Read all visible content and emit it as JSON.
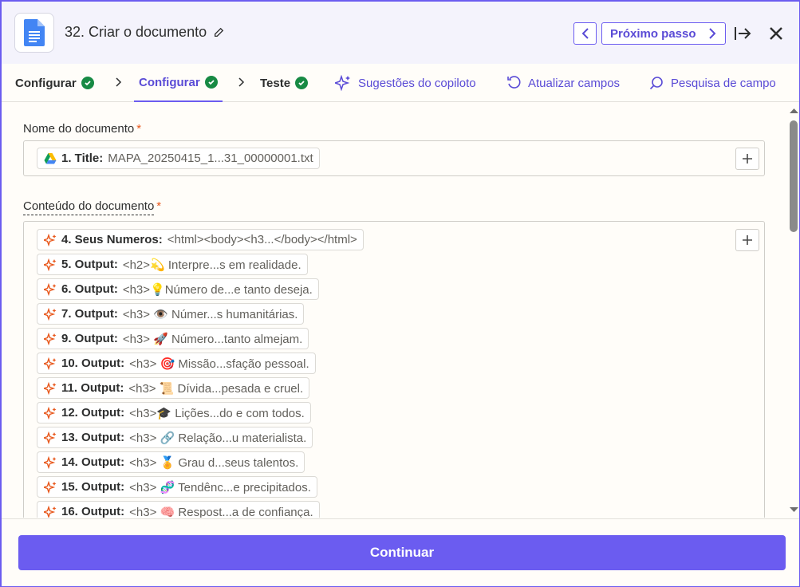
{
  "header": {
    "step_title": "32. Criar o documento",
    "next_step_label": "Próximo passo"
  },
  "tabs": [
    {
      "label": "Configurar",
      "done": true
    },
    {
      "label": "Configurar",
      "done": true,
      "active": true
    },
    {
      "label": "Teste",
      "done": true
    }
  ],
  "actions": {
    "copilot": "Sugestões do copiloto",
    "refresh": "Atualizar campos",
    "search": "Pesquisa de campo"
  },
  "fields": {
    "name": {
      "label": "Nome do documento",
      "required": "*",
      "pill": {
        "num": "1. Title:",
        "val": "MAPA_20250415_1...31_00000001.txt"
      }
    },
    "content": {
      "label": "Conteúdo do documento",
      "required": "*",
      "pills": [
        {
          "num": "4. Seus Numeros:",
          "val": "<html><body><h3...</body></html>"
        },
        {
          "num": "5. Output:",
          "val": "<h2>💫 Interpre...s em realidade."
        },
        {
          "num": "6. Output:",
          "val": "<h3>💡Número de...e tanto deseja."
        },
        {
          "num": "7. Output:",
          "val": "<h3> 👁️  Númer...s humanitárias."
        },
        {
          "num": "9. Output:",
          "val": "<h3> 🚀 Número...tanto almejam."
        },
        {
          "num": "10. Output:",
          "val": "<h3> 🎯 Missão...sfação pessoal."
        },
        {
          "num": "11. Output:",
          "val": "<h3> 📜  Dívida...pesada e cruel."
        },
        {
          "num": "12. Output:",
          "val": "<h3>🎓  Lições...do e com todos."
        },
        {
          "num": "13. Output:",
          "val": "<h3> 🔗 Relação...u materialista."
        },
        {
          "num": "14. Output:",
          "val": "<h3> 🏅 Grau d...seus talentos."
        },
        {
          "num": "15. Output:",
          "val": "<h3> 🧬 Tendênc...e precipitados."
        },
        {
          "num": "16. Output:",
          "val": "<h3> 🧠 Respost...a de confiança."
        }
      ]
    }
  },
  "footer": {
    "continue_label": "Continuar"
  },
  "colors": {
    "accent": "#6b5cf0",
    "success": "#178a44",
    "spark": "#e8571b"
  }
}
